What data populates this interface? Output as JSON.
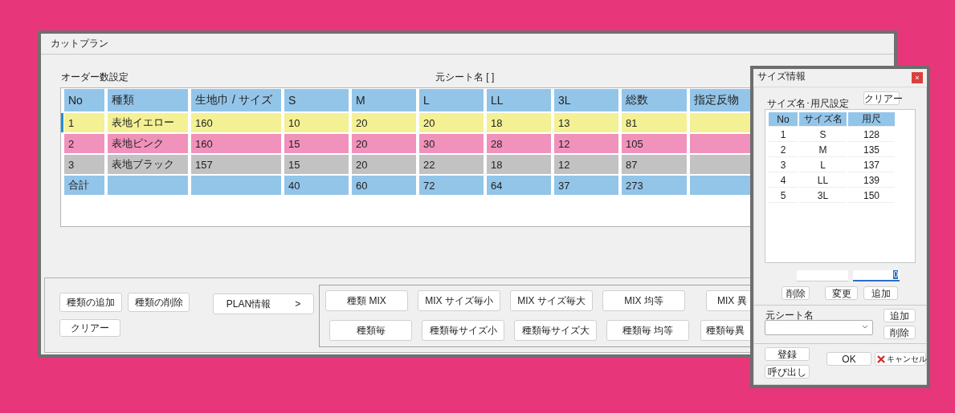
{
  "main_window": {
    "title": "カットプラン",
    "order_label": "オーダー数設定",
    "sheet_label": "元シート名 [ ]",
    "table": {
      "columns": [
        "No",
        "種類",
        "生地巾 / サイズ",
        "S",
        "M",
        "L",
        "LL",
        "3L",
        "総数",
        "指定反物"
      ],
      "rows": [
        {
          "cells": [
            "1",
            "表地イエロー",
            "160",
            "10",
            "20",
            "20",
            "18",
            "13",
            "81",
            null
          ],
          "color": "#f3f194",
          "selected": true
        },
        {
          "cells": [
            "2",
            "表地ピンク",
            "160",
            "15",
            "20",
            "30",
            "28",
            "12",
            "105",
            null
          ],
          "color": "#f092bb",
          "selected": false
        },
        {
          "cells": [
            "3",
            "表地ブラック",
            "157",
            "15",
            "20",
            "22",
            "18",
            "12",
            "87",
            null
          ],
          "color": "#c3c2c2",
          "selected": false
        },
        {
          "cells": [
            "合計",
            null,
            null,
            "40",
            "60",
            "72",
            "64",
            "37",
            "273",
            null
          ],
          "color": "#93c5e9",
          "selected": false
        }
      ]
    },
    "edit_buttons": [
      "種類の追加",
      "種類の削除"
    ],
    "clear_button": "クリアー",
    "plan_button": {
      "label": "PLAN情報",
      "arrow": ">"
    },
    "mix_buttons": [
      [
        "種類 MIX",
        "MIX サイズ毎小",
        "MIX サイズ毎大",
        "MIX 均等",
        "MIX 異"
      ],
      [
        "種類毎",
        "種類毎サイズ小",
        "種類毎サイズ大",
        "種類毎 均等",
        "種類毎異"
      ]
    ]
  },
  "size_dialog": {
    "title": "サイズ情報",
    "close": "×",
    "section_label": "サイズ名･用尺設定",
    "clear_button": "クリアー",
    "table": {
      "columns": [
        "No",
        "サイズ名",
        "用尺"
      ],
      "rows": [
        [
          "1",
          "S",
          "128"
        ],
        [
          "2",
          "M",
          "135"
        ],
        [
          "3",
          "L",
          "137"
        ],
        [
          "4",
          "LL",
          "139"
        ],
        [
          "5",
          "3L",
          "150"
        ]
      ]
    },
    "length_input": {
      "value": "0",
      "focused": true
    },
    "edit_buttons": [
      "削除",
      "変更",
      "追加"
    ],
    "sheet_label": "元シート名",
    "sheet_buttons": [
      "追加",
      "削除"
    ],
    "register_button": "登録",
    "load_button": "呼び出し",
    "ok_button": "OK",
    "cancel_button": "キャンセル"
  }
}
